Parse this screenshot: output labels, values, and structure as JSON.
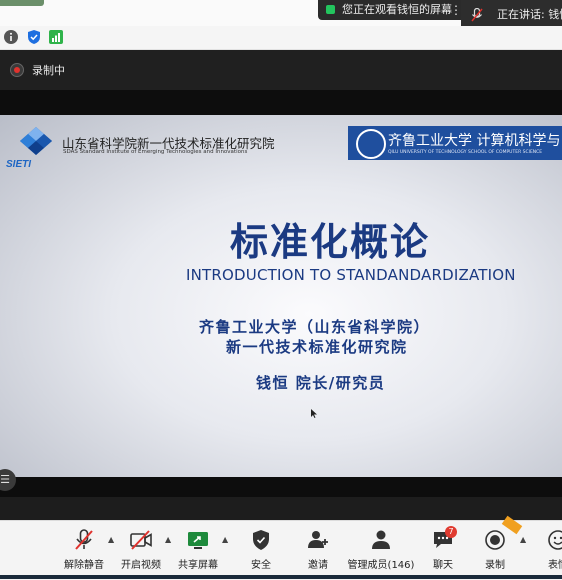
{
  "top": {
    "viewing_text": "您正在观看钱恒的屏幕",
    "speaking_text": "正在讲话: 钱恒"
  },
  "recording": {
    "label": "录制中"
  },
  "slide": {
    "institute_cn": "山东省科学院新一代技术标准化研究院",
    "institute_en": "SDAS Standard Institute of  Emerging Technologies and Innovations",
    "logo_text": "SIETI",
    "partner_cn": "齐鲁工业大学  计算机科学与",
    "partner_en": "QILU UNIVERSITY OF TECHNOLOGY        SCHOOL OF COMPUTER SCIENCE",
    "title_cn": "标准化概论",
    "title_en": "INTRODUCTION TO STANDANDARDIZATION",
    "org_line1": "齐鲁工业大学（山东省科学院）",
    "org_line2": "新一代技术标准化研究院",
    "person": "钱恒  院长/研究员"
  },
  "toolbar": {
    "unmute": "解除静音",
    "start_video": "开启视频",
    "share_screen": "共享屏幕",
    "security": "安全",
    "invite": "邀请",
    "participants": "管理成员(146)",
    "chat": "聊天",
    "chat_badge": "7",
    "record": "录制",
    "reactions": "表情"
  },
  "colors": {
    "slide_blue": "#1b3a82",
    "rec_red": "#e0322d",
    "badge_red": "#e03b30"
  }
}
